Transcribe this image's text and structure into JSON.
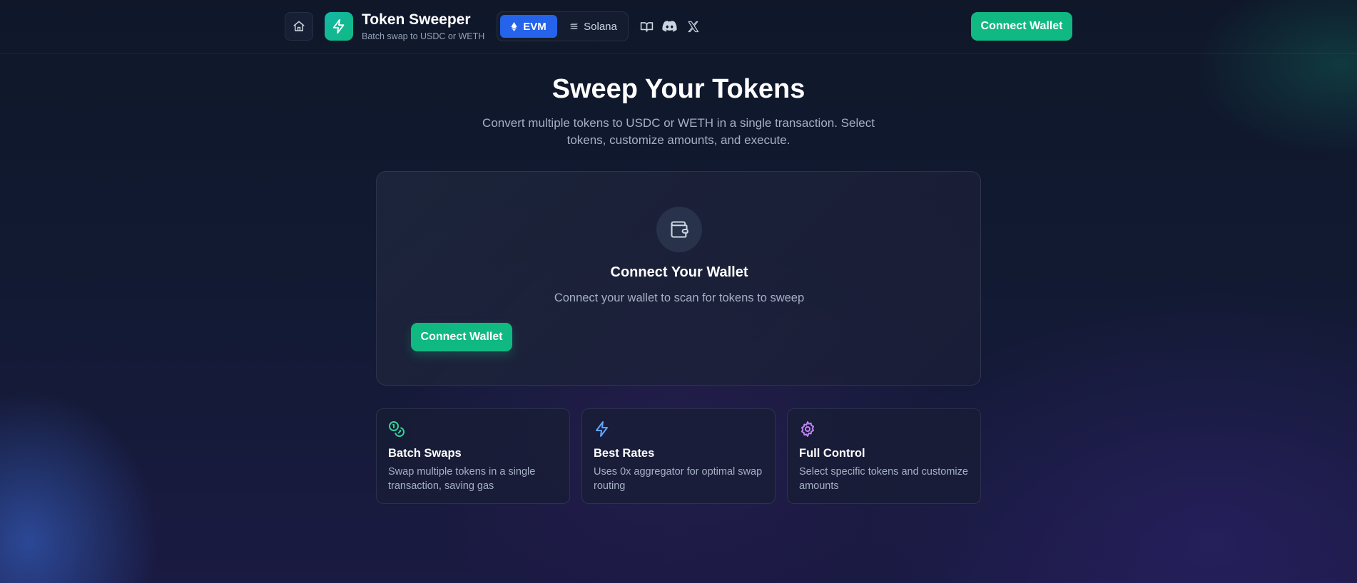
{
  "header": {
    "brand_title": "Token Sweeper",
    "brand_subtitle": "Batch swap to USDC or WETH",
    "chain_options": [
      {
        "label": "EVM",
        "icon": "ethereum-icon",
        "selected": true
      },
      {
        "label": "Solana",
        "icon": "solana-icon",
        "selected": false
      }
    ],
    "social_icons": [
      "docs-book-icon",
      "discord-icon",
      "x-icon"
    ],
    "connect_label": "Connect Wallet"
  },
  "hero": {
    "title": "Sweep Your Tokens",
    "subtitle": "Convert multiple tokens to USDC or WETH in a single transaction. Select tokens, customize amounts, and execute."
  },
  "connect_card": {
    "icon": "wallet-icon",
    "title": "Connect Your Wallet",
    "subtitle": "Connect your wallet to scan for tokens to sweep",
    "button_label": "Connect Wallet"
  },
  "features": [
    {
      "icon": "coins-icon",
      "title": "Batch Swaps",
      "description": "Swap multiple tokens in a single transaction, saving gas",
      "color": "#34d399"
    },
    {
      "icon": "zap-icon",
      "title": "Best Rates",
      "description": "Uses 0x aggregator for optimal swap routing",
      "color": "#60a5fa"
    },
    {
      "icon": "settings-icon",
      "title": "Full Control",
      "description": "Select specific tokens and customize amounts",
      "color": "#c084fc"
    }
  ],
  "colors": {
    "accent": "#10b981",
    "evm_selected": "#2563eb",
    "background": "#0f172a"
  }
}
